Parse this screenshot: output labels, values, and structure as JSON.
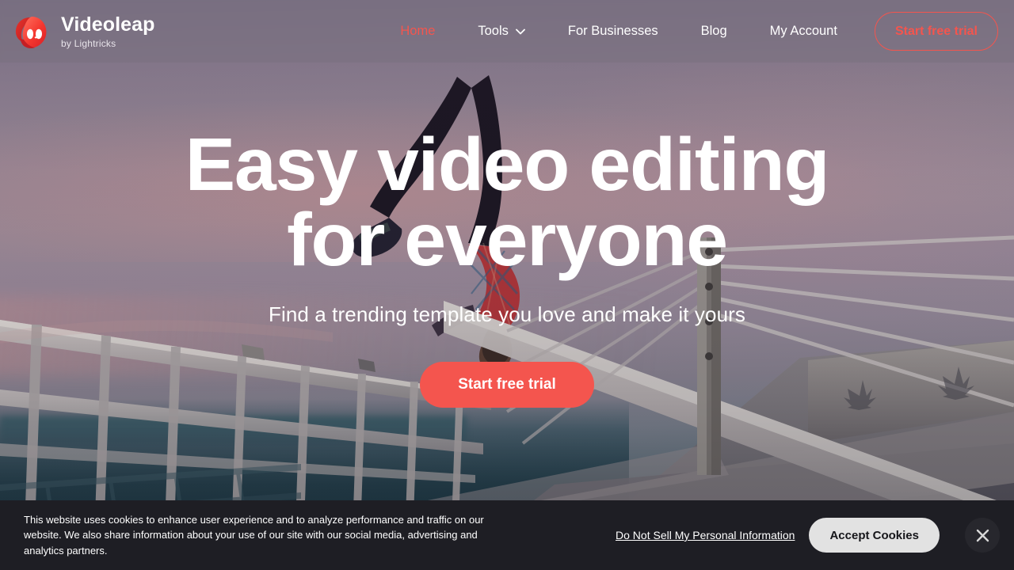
{
  "brand": {
    "name": "Videoleap",
    "tagline": "by Lightricks",
    "logo_icon": "videoleap-fox-logo-icon",
    "accent_color": "#F4554E"
  },
  "nav": {
    "links": [
      {
        "label": "Home",
        "active": true,
        "has_dropdown": false
      },
      {
        "label": "Tools",
        "active": false,
        "has_dropdown": true,
        "dropdown_icon": "chevron-down-icon"
      },
      {
        "label": "For Businesses",
        "active": false,
        "has_dropdown": false
      },
      {
        "label": "Blog",
        "active": false,
        "has_dropdown": false
      },
      {
        "label": "My Account",
        "active": false,
        "has_dropdown": false
      }
    ],
    "cta_label": "Start free trial",
    "background_color": "rgba(120,112,126,0.50)"
  },
  "hero": {
    "title": "Easy video editing for everyone",
    "subtitle": "Find a trending template you love and make it yours",
    "cta_label": "Start free trial",
    "cta_color": "#F4554E",
    "background_description": "Silhouette of a person doing a handstand flip on a cable-stayed bridge at dusk with a pink-purple sky"
  },
  "cookie_banner": {
    "message": "This website uses cookies to enhance user experience and to analyze performance and traffic on our website. We also share information about your use of our site with our social media, advertising and analytics partners.",
    "do_not_sell_label": "Do Not Sell My Personal Information",
    "accept_label": "Accept Cookies",
    "close_icon": "close-icon",
    "background_color": "#1E1E24",
    "accept_button_color": "#E2E2E2"
  }
}
